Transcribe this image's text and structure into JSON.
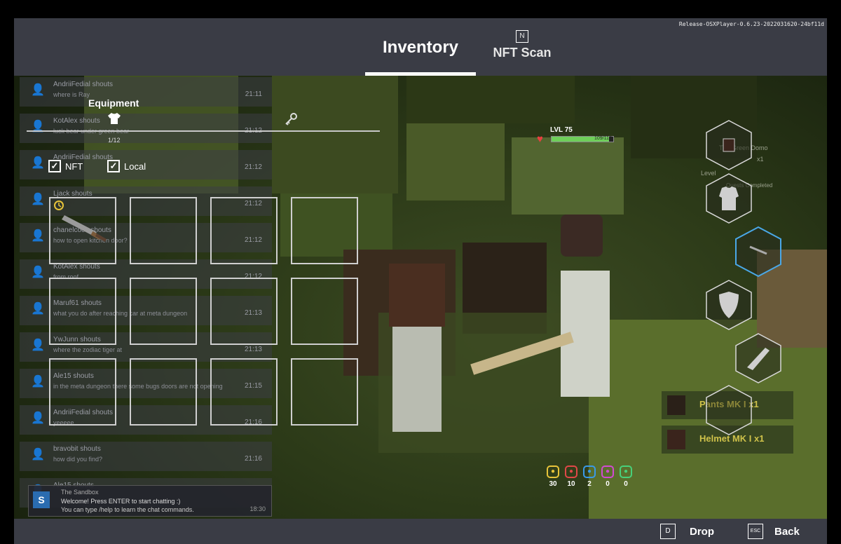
{
  "version": "Release-OSXPlayer-0.6.23-2022031620-24bf11d",
  "tabs": {
    "inventory": "Inventory",
    "nft_scan": "NFT Scan",
    "nft_scan_key": "N"
  },
  "footer": {
    "drop_key": "D",
    "drop_label": "Drop",
    "back_key": "ESC",
    "back_label": "Back"
  },
  "equipment": {
    "title": "Equipment",
    "count": "1/12",
    "filters": [
      {
        "label": "NFT",
        "checked": true
      },
      {
        "label": "Local",
        "checked": true
      }
    ],
    "slots_total": 12
  },
  "chat": {
    "messages": [
      {
        "name": "AndriiFedial shouts",
        "text": "where is Ray",
        "time": "21:11"
      },
      {
        "name": "KotAlex shouts",
        "text": "luck bear under green bear",
        "time": "21:12"
      },
      {
        "name": "AndriiFedial shouts",
        "text": "",
        "time": "21:12"
      },
      {
        "name": "Ljack shouts",
        "text": "",
        "time": "21:12"
      },
      {
        "name": "chanelcoco shouts",
        "text": "how to open kitchen door?",
        "time": "21:12"
      },
      {
        "name": "KotAlex shouts",
        "text": "from roof",
        "time": "21:12"
      },
      {
        "name": "Maruf61 shouts",
        "text": "what you do after reaching car at meta dungeon",
        "time": "21:13"
      },
      {
        "name": "YwJunn shouts",
        "text": "where the zodiac tiger at",
        "time": "21:13"
      },
      {
        "name": "Ale15 shouts",
        "text": "in the meta dungeon there some bugs doors are not opening",
        "time": "21:15"
      },
      {
        "name": "AndriiFedial shouts",
        "text": "yeeeee",
        "time": "21:16"
      },
      {
        "name": "bravobit shouts",
        "text": "how did you find?",
        "time": "21:16"
      },
      {
        "name": "Ale15 shouts",
        "text": "",
        "time": ""
      }
    ],
    "system": {
      "logo": "S",
      "name": "The Sandbox",
      "line1": "Welcome! Press ENTER to start chatting :)",
      "line2": "You can type  /help  to learn the chat commands.",
      "time": "18:30"
    }
  },
  "hud": {
    "level": "LVL 75",
    "hp": {
      "current": 109,
      "max": 117,
      "text": "109/117"
    },
    "stats": [
      {
        "value": "30",
        "color": "#e8c43a",
        "icon": "lightning-icon"
      },
      {
        "value": "10",
        "color": "#e04848",
        "icon": "shield-stat-icon"
      },
      {
        "value": "2",
        "color": "#3a9ae8",
        "icon": "speed-icon"
      },
      {
        "value": "0",
        "color": "#d24ad2",
        "icon": "magic-icon"
      },
      {
        "value": "0",
        "color": "#48d07a",
        "icon": "luck-icon"
      }
    ],
    "quest": {
      "title": "The Green Domo",
      "count": "x1",
      "level": "Level",
      "progress": "Quests Completed"
    },
    "items": [
      {
        "name": "Pants MK I",
        "qty": "x1"
      },
      {
        "name": "Helmet MK I",
        "qty": "x1"
      }
    ]
  }
}
